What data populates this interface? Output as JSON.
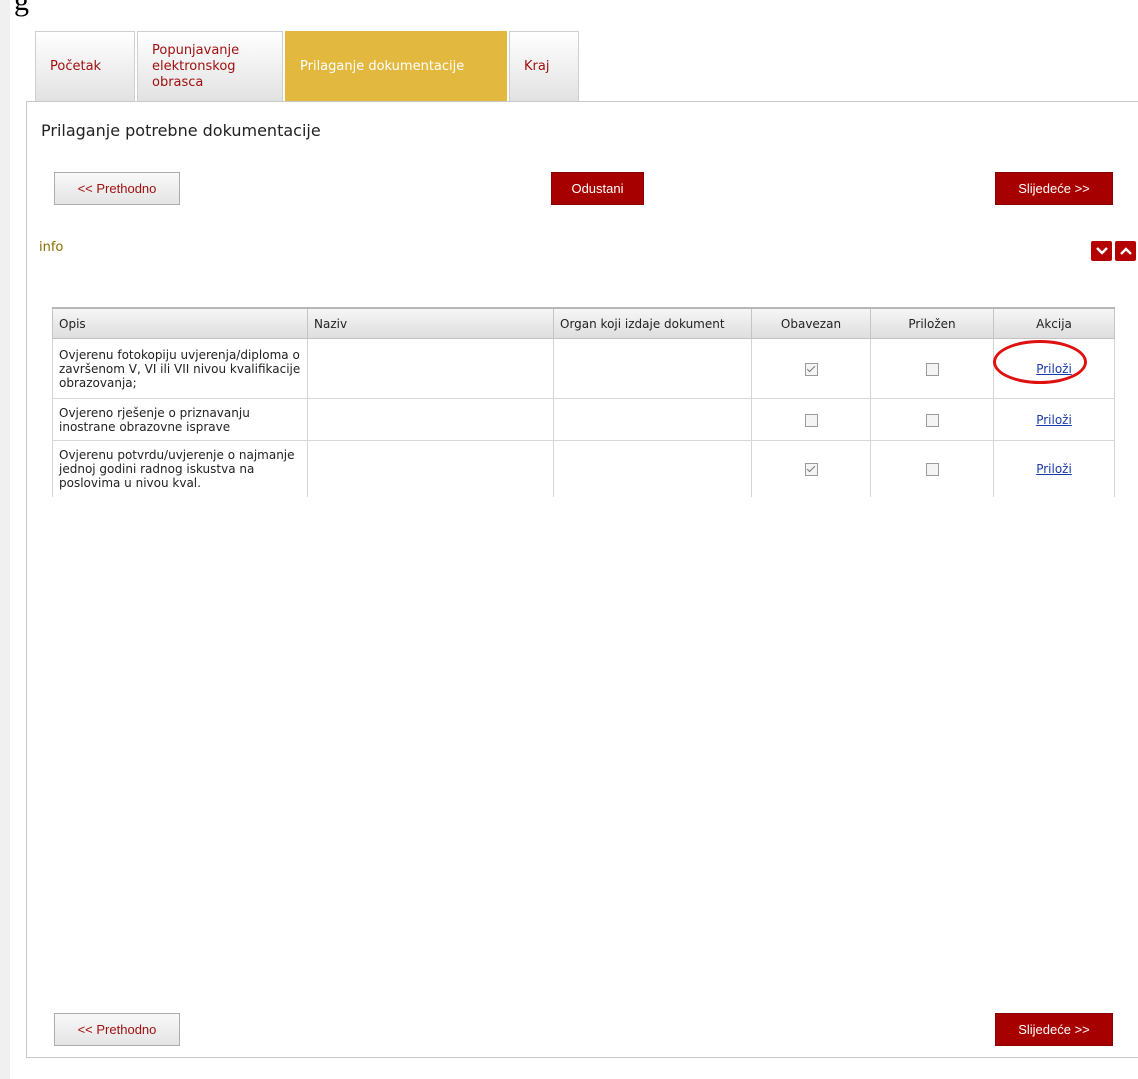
{
  "tabs": [
    {
      "label": "Početak",
      "active": false
    },
    {
      "label": "Popunjavanje elektronskog obrasca",
      "active": false
    },
    {
      "label": "Prilaganje dokumentacije",
      "active": true
    },
    {
      "label": "Kraj",
      "active": false
    }
  ],
  "header_fragment": "g",
  "section_title": "Prilaganje potrebne dokumentacije",
  "buttons": {
    "prev": "<< Prethodno",
    "cancel": "Odustani",
    "next": "Slijedeće >>"
  },
  "info_label": "info",
  "table": {
    "columns": [
      "Opis",
      "Naziv",
      "Organ koji izdaje dokument",
      "Obavezan",
      "Priložen",
      "Akcija"
    ],
    "rows": [
      {
        "opis": "Ovjerenu fotokopiju uvjerenja/diploma o završenom V, VI ili VII nivou kvalifikacije obrazovanja;",
        "naziv": "",
        "organ": "",
        "obavezan": true,
        "prilozen": false,
        "akcija": "Priloži"
      },
      {
        "opis": "Ovjereno rješenje o priznavanju inostrane obrazovne isprave",
        "naziv": "",
        "organ": "",
        "obavezan": false,
        "prilozen": false,
        "akcija": "Priloži"
      },
      {
        "opis": "Ovjerenu potvrdu/uvjerenje o najmanje jednoj godini radnog iskustva na poslovima u nivou kval.",
        "naziv": "",
        "organ": "",
        "obavezan": true,
        "prilozen": false,
        "akcija": "Priloži"
      }
    ]
  },
  "colors": {
    "accent_red": "#a70000",
    "active_tab": "#e2b83e",
    "link": "#1a3aa8",
    "highlight": "#e01010"
  }
}
